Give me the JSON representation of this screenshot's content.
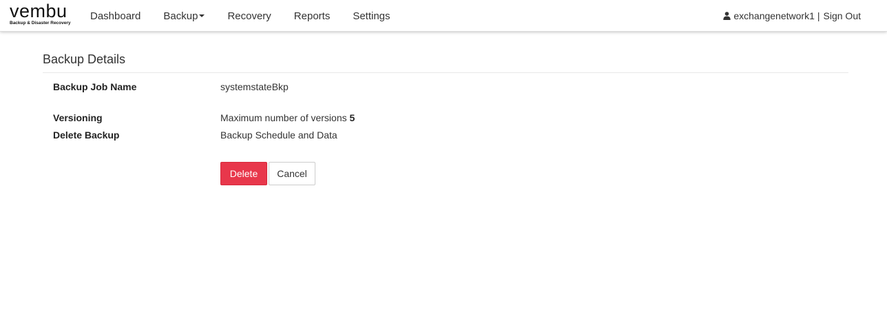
{
  "brand": {
    "logo_text": "vembu",
    "tagline": "Backup & Disaster Recovery"
  },
  "nav": {
    "items": [
      {
        "label": "Dashboard"
      },
      {
        "label": "Backup",
        "dropdown": true
      },
      {
        "label": "Recovery"
      },
      {
        "label": "Reports"
      },
      {
        "label": "Settings"
      }
    ],
    "user": {
      "icon": "user-icon",
      "name": "exchangenetwork1",
      "separator": "|",
      "signout_label": "Sign Out"
    }
  },
  "page": {
    "title": "Backup Details",
    "rows": [
      {
        "label": "Backup Job Name",
        "value": "systemstateBkp"
      },
      {
        "label": "Versioning",
        "value_prefix": "Maximum number of versions",
        "value_emphasis": "5"
      },
      {
        "label": "Delete Backup",
        "value": "Backup Schedule and Data"
      }
    ]
  },
  "actions": {
    "delete_label": "Delete",
    "cancel_label": "Cancel"
  },
  "colors": {
    "delete_button": "#e8374b",
    "text": "#333333"
  }
}
